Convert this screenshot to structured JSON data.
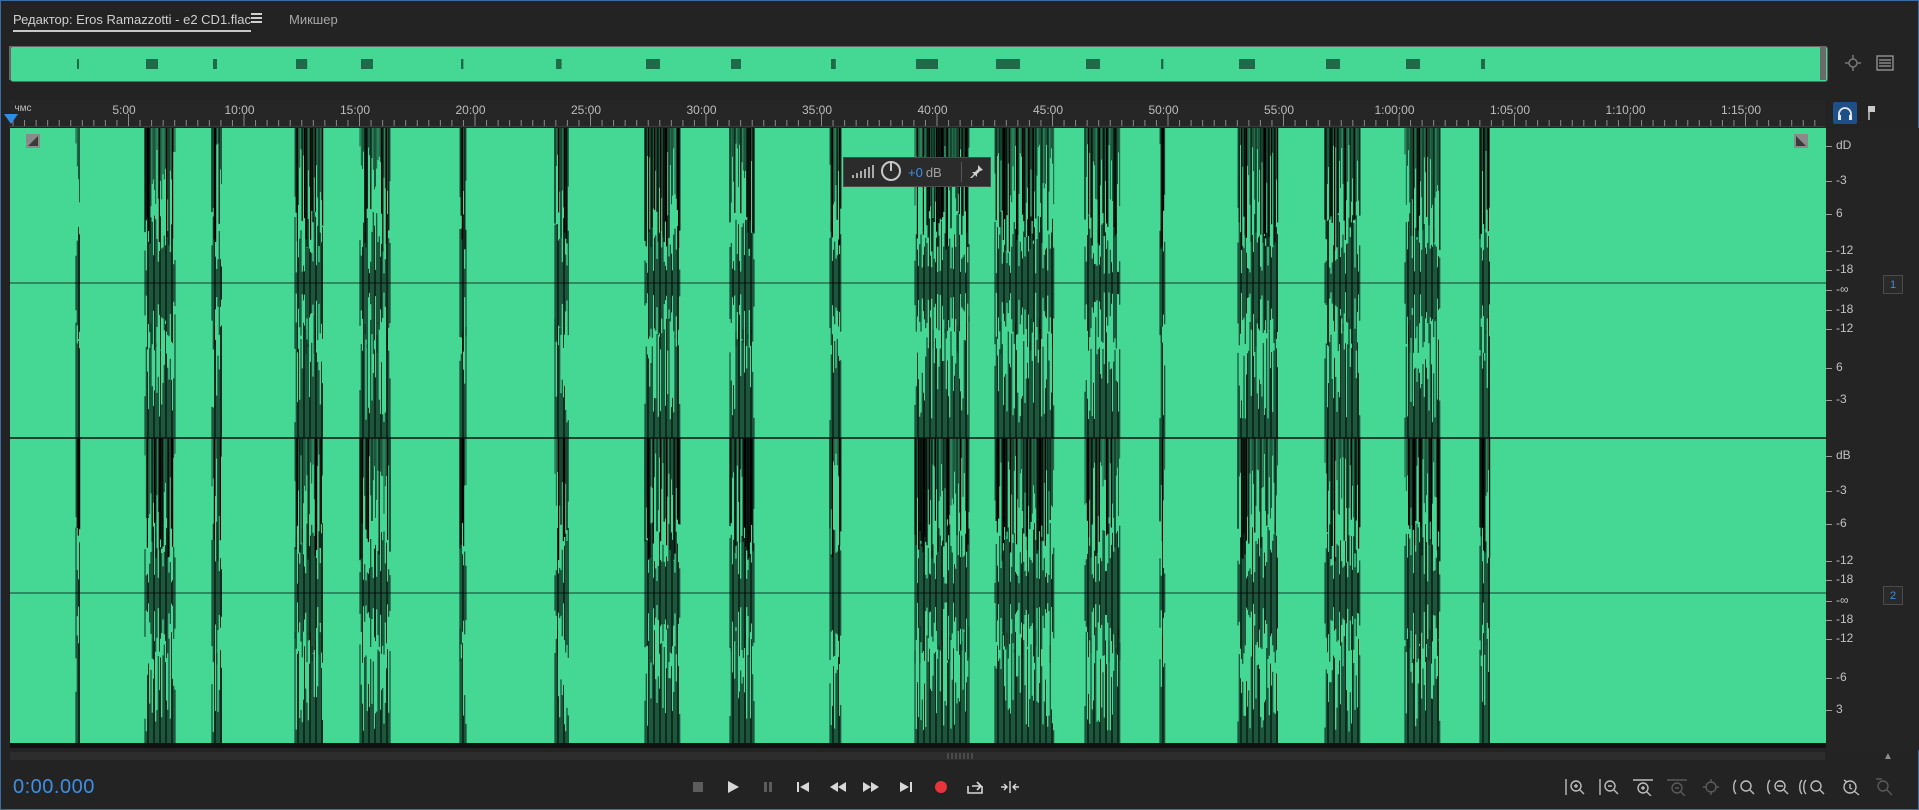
{
  "tabs": {
    "editor_label": "Редактор: Eros Ramazzotti - e2 CD1.flac",
    "mixer_label": "Микшер"
  },
  "ruler": {
    "unit_label": "чмс",
    "labels": [
      "5:00",
      "10:00",
      "15:00",
      "20:00",
      "25:00",
      "30:00",
      "35:00",
      "40:00",
      "45:00",
      "50:00",
      "55:00",
      "1:00:00",
      "1:05:00",
      "1:10:00",
      "1:15:00"
    ]
  },
  "hud": {
    "volume_value": "+0",
    "volume_unit": "dB"
  },
  "scale": {
    "channel1_labels": [
      "dD",
      "-3",
      "6",
      "-12",
      "-18",
      "-∞",
      "-18",
      "-12",
      "6",
      "-3"
    ],
    "channel2_labels": [
      "dB",
      "-3",
      "-6",
      "-12",
      "-18",
      "-∞",
      "-18",
      "-12",
      "-6",
      "3"
    ],
    "channel1_badge": "1",
    "channel2_badge": "2"
  },
  "transport": {
    "time_display": "0:00.000"
  },
  "colors": {
    "waveform": "#45d895",
    "accent": "#3e8fe3",
    "record": "#e8343b",
    "background": "#232323"
  },
  "icons": [
    "menu-icon",
    "zoom-to-selection-icon",
    "list-icon",
    "headphones-icon",
    "marker-icon",
    "volume-meter-icon",
    "knob-icon",
    "pin-icon",
    "stop-icon",
    "play-icon",
    "pause-icon",
    "go-to-start-icon",
    "rewind-icon",
    "fast-forward-icon",
    "go-to-end-icon",
    "record-icon",
    "loop-icon",
    "skip-selection-icon",
    "zoom-in-amplitude-icon",
    "zoom-out-amplitude-icon",
    "zoom-in-time-icon",
    "zoom-out-time-icon",
    "zoom-full-icon",
    "zoom-in-selection-icon",
    "zoom-out-selection-icon",
    "zoom-in-out-icon",
    "zoom-reset-icon",
    "zoom-settings-icon"
  ]
}
